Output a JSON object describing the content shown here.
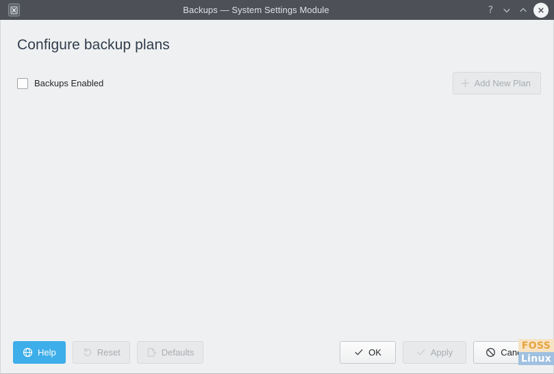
{
  "window": {
    "title": "Backups — System Settings Module",
    "app_icon": "backups-icon",
    "controls": {
      "help": "?",
      "minimize": "minimize-icon",
      "maximize": "maximize-icon",
      "close": "close-icon"
    }
  },
  "main": {
    "page_title": "Configure backup plans",
    "backups_enabled": {
      "label": "Backups Enabled",
      "checked": false
    },
    "add_new_plan": {
      "label": "Add New Plan",
      "icon": "plus-icon",
      "enabled": false
    }
  },
  "buttonbar": {
    "help": {
      "label": "Help",
      "icon": "help-globe-icon",
      "enabled": true
    },
    "reset": {
      "label": "Reset",
      "icon": "undo-arrow-icon",
      "enabled": false
    },
    "defaults": {
      "label": "Defaults",
      "icon": "document-revert-icon",
      "enabled": false
    },
    "ok": {
      "label": "OK",
      "icon": "check-icon",
      "enabled": true
    },
    "apply": {
      "label": "Apply",
      "icon": "check-icon",
      "enabled": false
    },
    "cancel": {
      "label": "Cancel",
      "icon": "no-entry-icon",
      "enabled": true
    }
  },
  "watermark": {
    "line1": "FOSS",
    "line2": "Linux"
  },
  "colors": {
    "titlebar": "#4d5157",
    "background": "#eff0f1",
    "accent": "#3daee9",
    "heading": "#2f3c4c",
    "text": "#232629",
    "disabled_text": "#a8adb2"
  }
}
